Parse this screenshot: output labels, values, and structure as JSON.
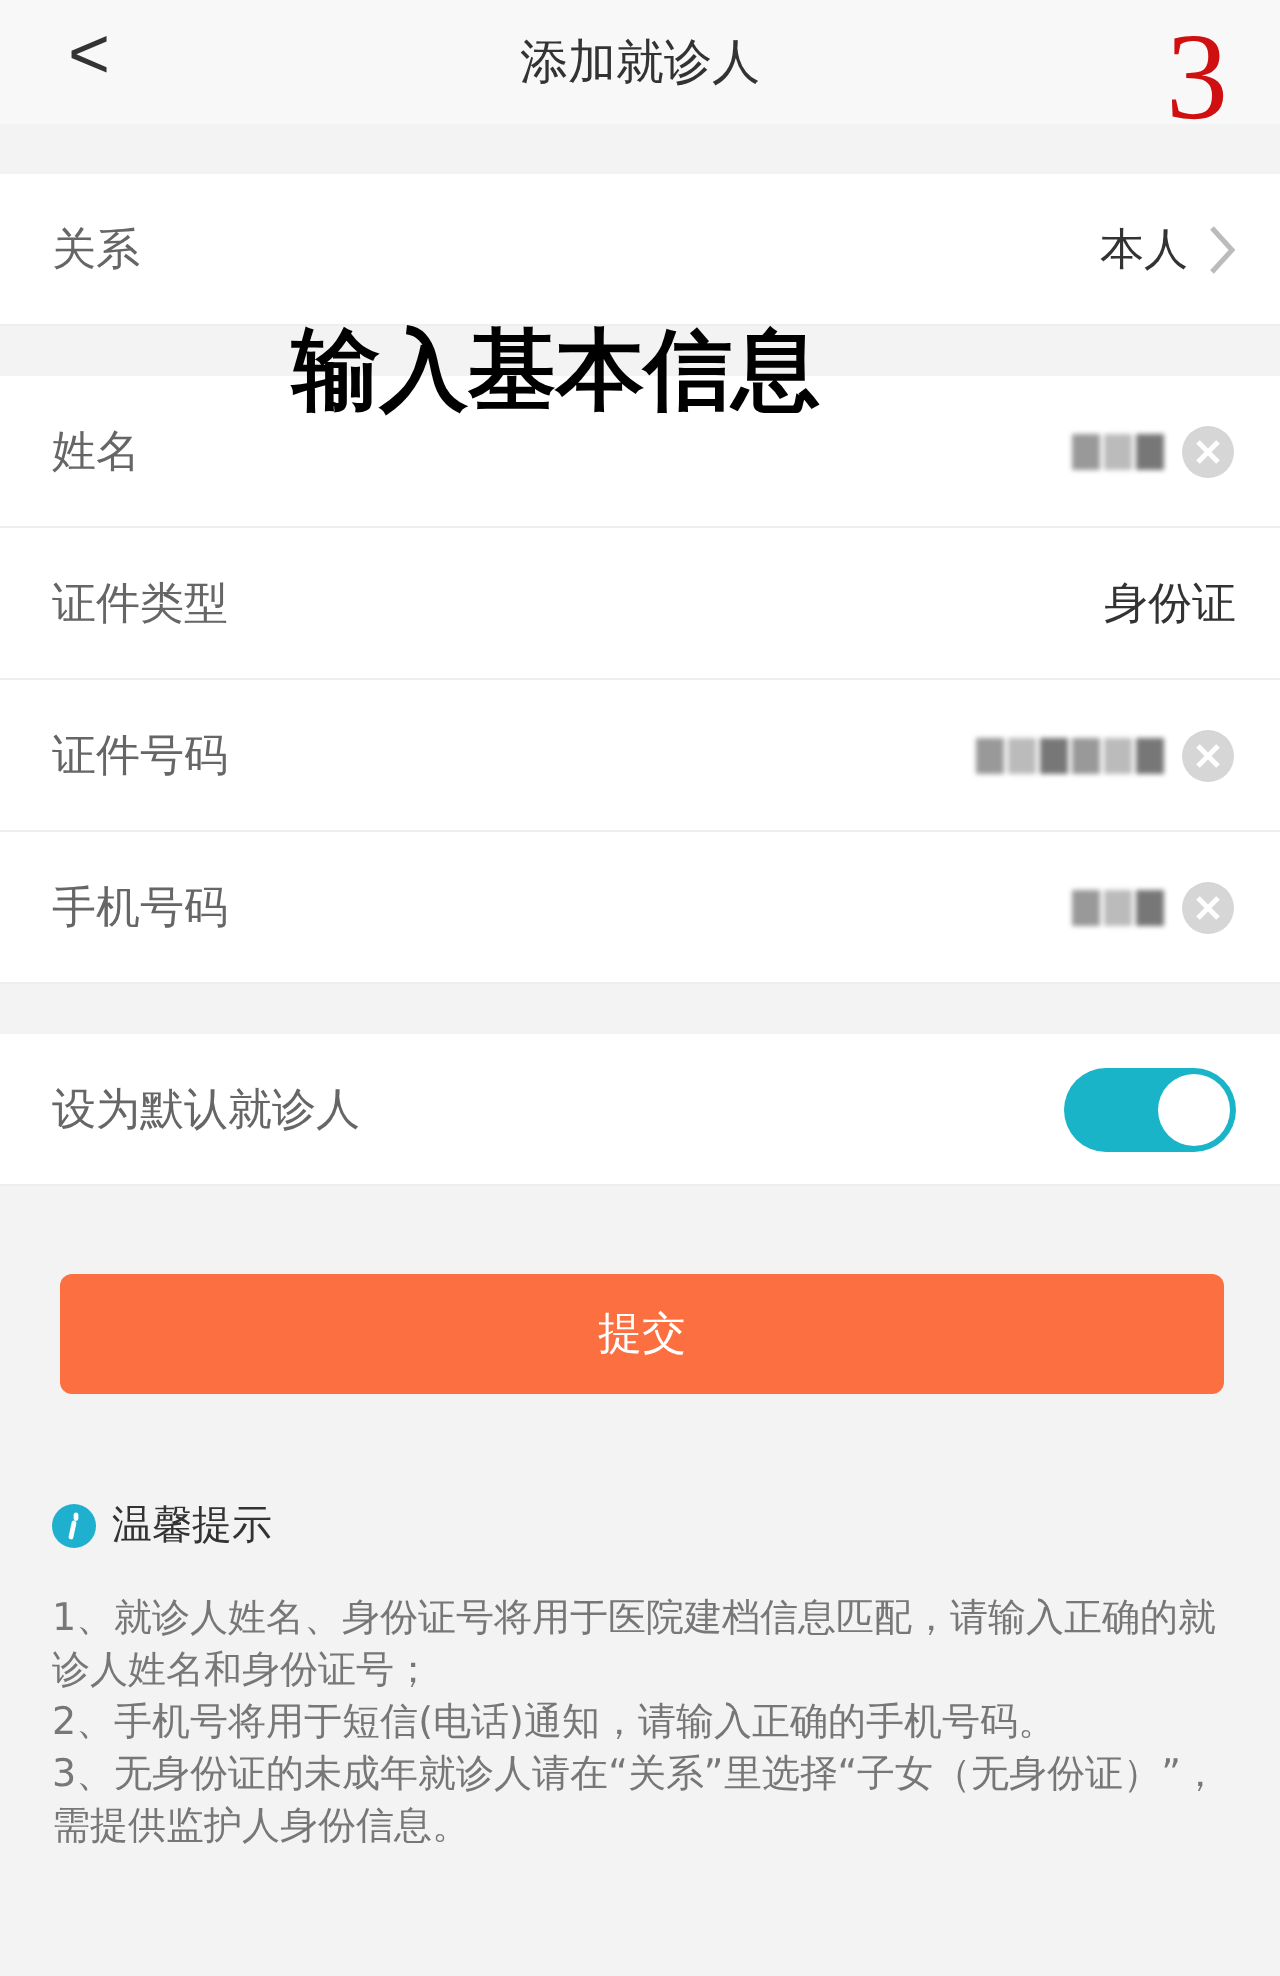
{
  "header": {
    "back": "<",
    "title": "添加就诊人",
    "step": "3"
  },
  "relation": {
    "label": "关系",
    "value": "本人"
  },
  "annotation": "输入基本信息",
  "fields": [
    {
      "label": "姓名",
      "kind": "redacted"
    },
    {
      "label": "证件类型",
      "kind": "text",
      "value": "身份证"
    },
    {
      "label": "证件号码",
      "kind": "redacted"
    },
    {
      "label": "手机号码",
      "kind": "redacted"
    }
  ],
  "default_patient": {
    "label": "设为默认就诊人",
    "on": true
  },
  "submit": "提交",
  "tips": {
    "title": "温馨提示",
    "lines": [
      "1、就诊人姓名、身份证号将用于医院建档信息匹配，请输入正确的就诊人姓名和身份证号；",
      "2、手机号将用于短信(电话)通知，请输入正确的手机号码。",
      "3、无身份证的未成年就诊人请在“关系”里选择“子女（无身份证）”，需提供监护人身份信息。"
    ]
  }
}
